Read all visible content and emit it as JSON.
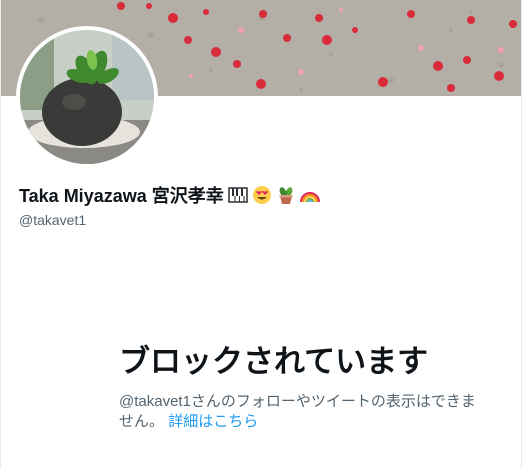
{
  "profile": {
    "display_name": "Taka Miyazawa 宮沢孝幸",
    "handle": "@takavet1",
    "name_emojis": [
      "piano-keys-icon",
      "heart-eyes-icon",
      "potted-plant-icon",
      "rainbow-icon"
    ]
  },
  "blocked": {
    "title": "ブロックされています",
    "message": "@takavet1さんのフォローやツイートの表示はできません。",
    "link_label": "詳細はこちら"
  },
  "colors": {
    "link": "#1d9bf0",
    "text_primary": "#0f1419",
    "text_secondary": "#536471"
  }
}
